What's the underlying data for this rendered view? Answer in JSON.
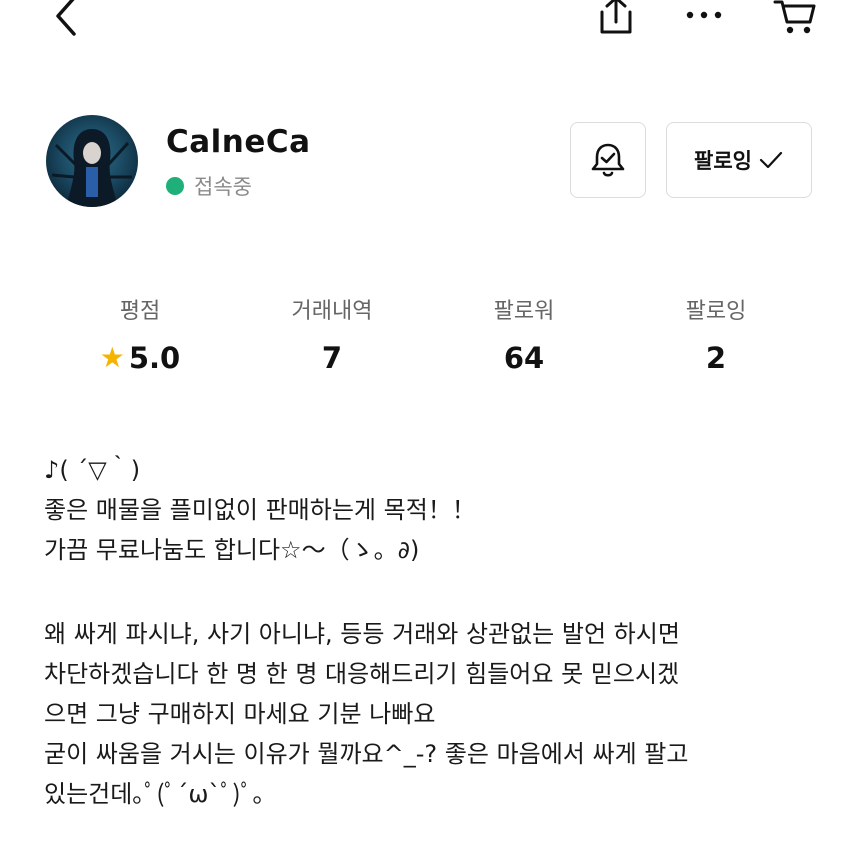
{
  "topbar": {
    "back_icon": "chevron-left-icon",
    "share_icon": "share-icon",
    "more_icon": "more-dots-icon",
    "cart_icon": "cart-icon"
  },
  "profile": {
    "username": "CalneCa",
    "status": "접속중",
    "status_color": "#1fb07a",
    "notify_icon": "bell-check-icon",
    "follow_label": "팔로잉"
  },
  "stats": [
    {
      "label": "평점",
      "value": "5.0",
      "icon": "star-icon"
    },
    {
      "label": "거래내역",
      "value": "7"
    },
    {
      "label": "팔로워",
      "value": "64"
    },
    {
      "label": "팔로잉",
      "value": "2"
    }
  ],
  "bio": {
    "lines_a": [
      "♪( ´▽｀)",
      "좋은 매물을 플미없이 판매하는게 목적！！",
      "가끔 무료나눔도 합니다☆～（ゝ。∂)"
    ],
    "lines_b": [
      "왜 싸게 파시냐, 사기 아니냐, 등등 거래와 상관없는 발언 하시면",
      "차단하겠습니다 한 명 한 명 대응해드리기 힘들어요 못 믿으시겠",
      "으면 그냥 구매하지 마세요 기분 나빠요",
      "굳이 싸움을 거시는 이유가 뭘까요^_-? 좋은 마음에서 싸게 팔고",
      "있는건데｡ﾟ(ﾟ´ω`ﾟ)ﾟ｡"
    ]
  }
}
